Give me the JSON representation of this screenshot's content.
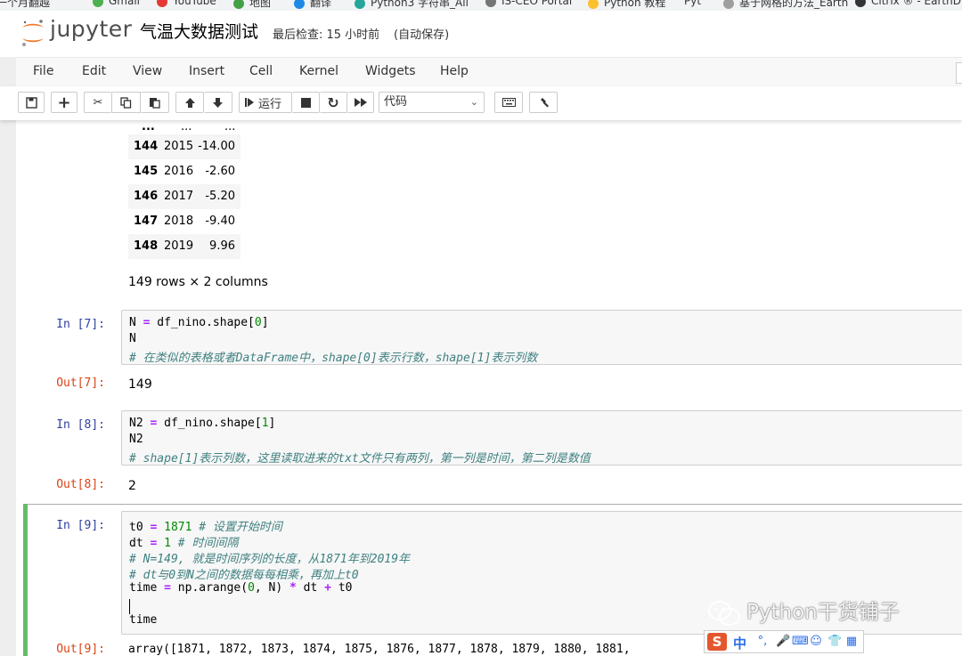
{
  "bookmarks": [
    "一个月翻越",
    "Gmail",
    "YouTube",
    "地图",
    "翻译",
    "Python3 字符串_All",
    "IS-CEO Portal",
    "Python 教程",
    "Pyt",
    "基于网格的方法_Earth",
    "Citrix ® - EarthDy"
  ],
  "app": {
    "logo_text": "jupyter",
    "notebook_title": "气温大数据测试",
    "checkpoint": "最后检查: 15 小时前",
    "autosave": "(自动保存)"
  },
  "menu": [
    "File",
    "Edit",
    "View",
    "Insert",
    "Cell",
    "Kernel",
    "Widgets",
    "Help"
  ],
  "toolbar": {
    "run_label": "运行",
    "cell_type": "代码"
  },
  "dataframe": {
    "ellipsis": [
      "...",
      "...",
      "..."
    ],
    "rows": [
      {
        "index": "144",
        "year": "2015",
        "value": "-14.00"
      },
      {
        "index": "145",
        "year": "2016",
        "value": "-2.60"
      },
      {
        "index": "146",
        "year": "2017",
        "value": "-5.20"
      },
      {
        "index": "147",
        "year": "2018",
        "value": "-9.40"
      },
      {
        "index": "148",
        "year": "2019",
        "value": "9.96"
      }
    ],
    "summary": "149 rows × 2 columns"
  },
  "cells": [
    {
      "in_prompt": "In  [7]:",
      "lines": [
        "N = df_nino.shape[0]",
        "N",
        "# 在类似的表格或者DataFrame中，shape[0]表示行数，shape[1]表示列数"
      ],
      "out_prompt": "Out[7]:",
      "output": "149"
    },
    {
      "in_prompt": "In  [8]:",
      "lines": [
        "N2 = df_nino.shape[1]",
        "N2",
        "# shape[1]表示列数，这里读取进来的txt文件只有两列，第一列是时间，第二列是数值"
      ],
      "out_prompt": "Out[8]:",
      "output": "2"
    },
    {
      "in_prompt": "In  [9]:",
      "lines": [
        "t0 = 1871 # 设置开始时间",
        "dt = 1 # 时间间隔",
        "# N=149, 就是时间序列的长度，从1871年到2019年",
        "# dt与0到N之间的数据每每相乘，再加上t0",
        "time = np.arange(0, N) * dt + t0",
        "",
        "time"
      ],
      "out_prompt": "Out[9]:",
      "output": "array([1871, 1872, 1873, 1874, 1875, 1876, 1877, 1878, 1879, 1880, 1881,"
    }
  ],
  "watermark": "Python干货铺子",
  "ime": {
    "logo": "S",
    "mode": "中",
    "punct": "°,"
  }
}
